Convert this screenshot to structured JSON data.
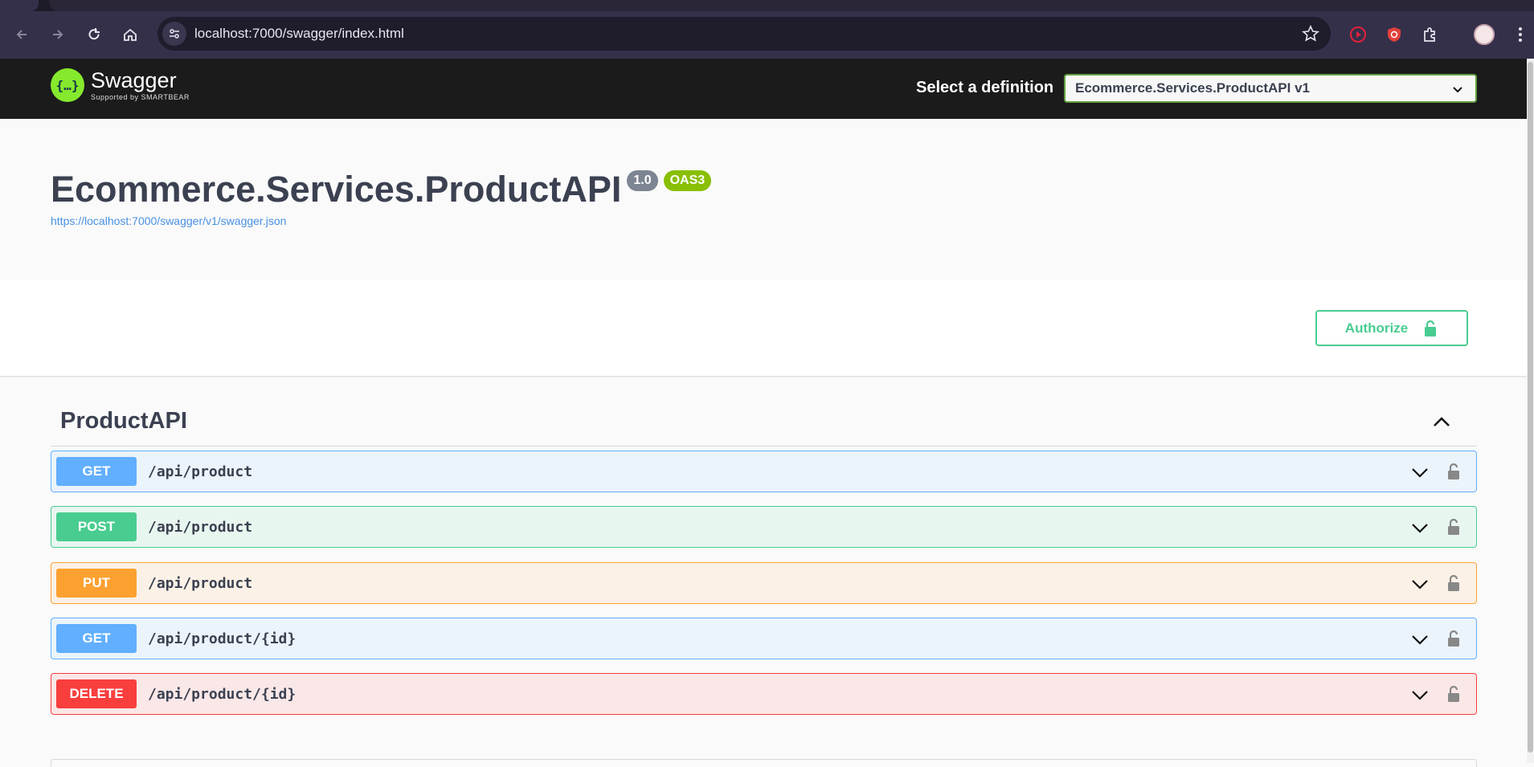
{
  "browser": {
    "url": "localhost:7000/swagger/index.html"
  },
  "swagger": {
    "logo_name": "Swagger",
    "logo_sub": "Supported by SMARTBEAR",
    "definition_label": "Select a definition",
    "definition_value": "Ecommerce.Services.ProductAPI v1"
  },
  "info": {
    "title": "Ecommerce.Services.ProductAPI",
    "version": "1.0",
    "oas": "OAS3",
    "spec_url": "https://localhost:7000/swagger/v1/swagger.json"
  },
  "authorize": {
    "label": "Authorize"
  },
  "tag": {
    "name": "ProductAPI"
  },
  "operations": [
    {
      "method": "GET",
      "path": "/api/product"
    },
    {
      "method": "POST",
      "path": "/api/product"
    },
    {
      "method": "PUT",
      "path": "/api/product"
    },
    {
      "method": "GET",
      "path": "/api/product/{id}"
    },
    {
      "method": "DELETE",
      "path": "/api/product/{id}"
    }
  ],
  "colors": {
    "get": "#61affe",
    "post": "#49cc90",
    "put": "#fca130",
    "delete": "#f93e3e",
    "swagger_green": "#85ea2d"
  }
}
